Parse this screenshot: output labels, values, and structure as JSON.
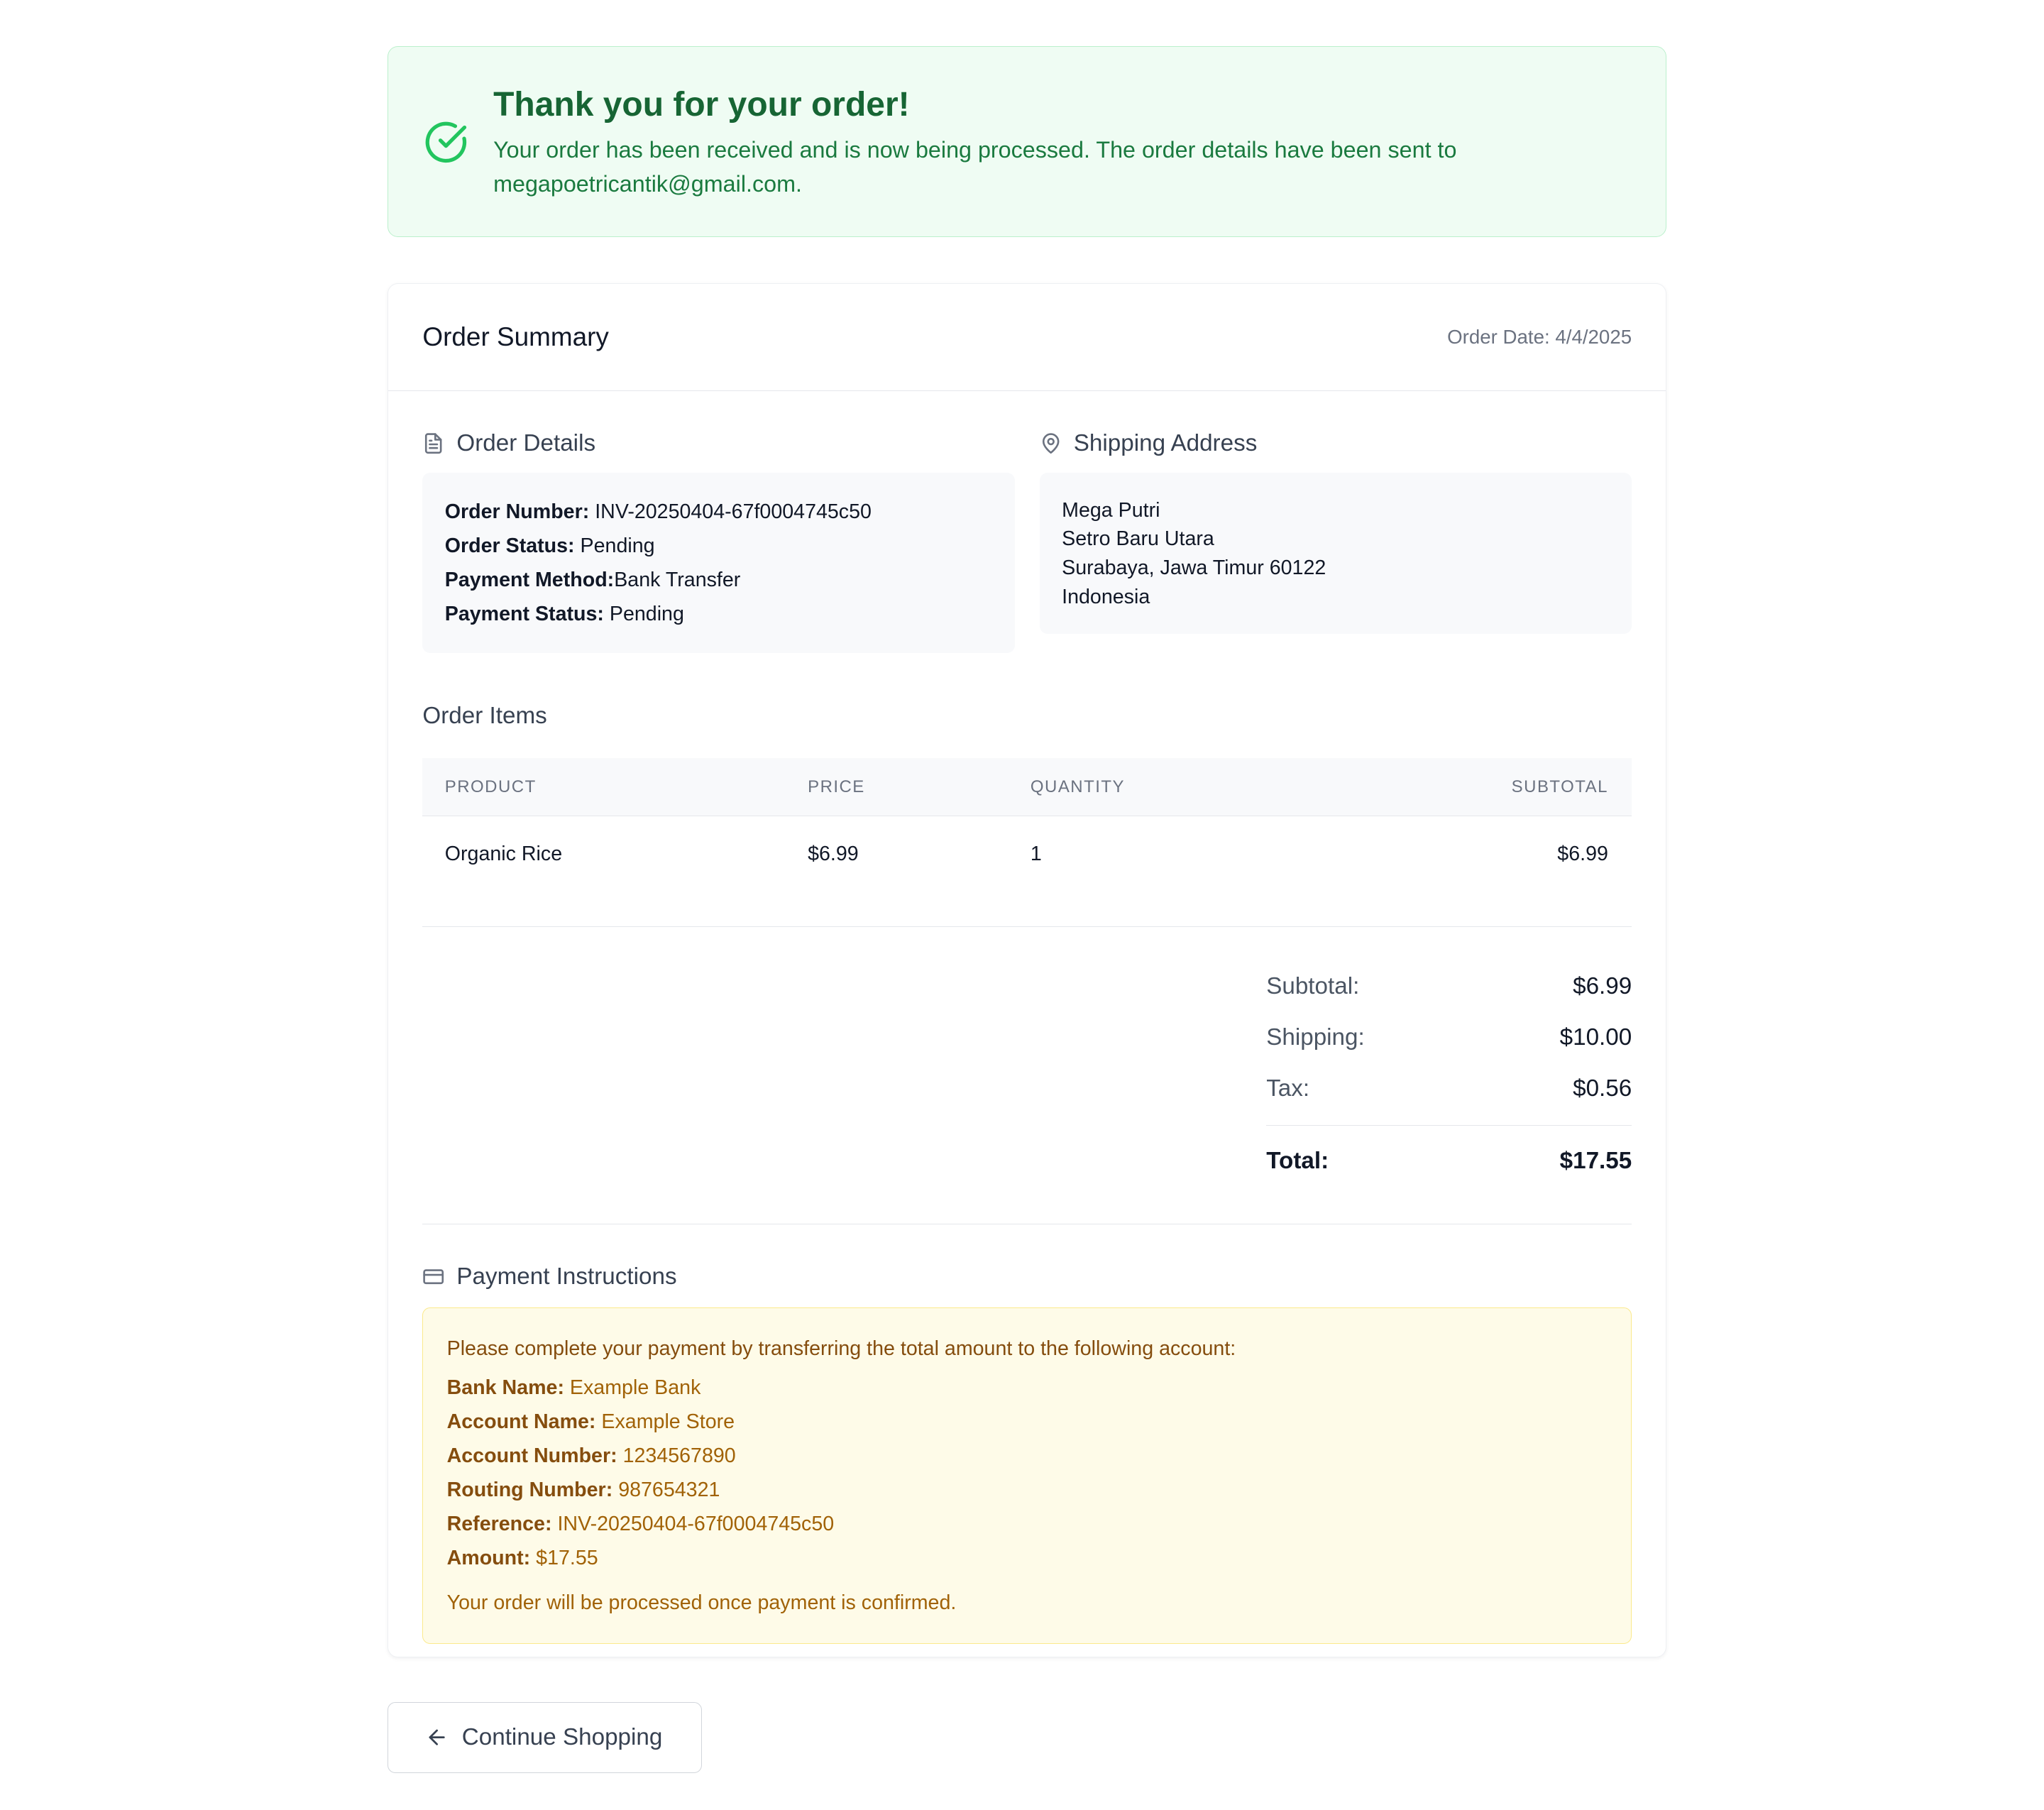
{
  "banner": {
    "title": "Thank you for your order!",
    "message": "Your order has been received and is now being processed. The order details have been sent to megapoetricantik@gmail.com.",
    "icon": "check-circle-icon",
    "accent": "#22c55e"
  },
  "summary": {
    "title": "Order Summary",
    "date": "Order Date: 4/4/2025"
  },
  "order_details": {
    "title": "Order Details",
    "number_label": "Order Number:",
    "number": "INV-20250404-67f0004745c50",
    "status_label": "Order Status:",
    "status": "Pending",
    "method_label": "Payment Method:",
    "method": "Bank Transfer",
    "pay_status_label": "Payment Status:",
    "pay_status": "Pending"
  },
  "shipping": {
    "title": "Shipping Address",
    "name": "Mega Putri",
    "street": "Setro Baru Utara",
    "city": "Surabaya, Jawa Timur 60122",
    "country": "Indonesia"
  },
  "items": {
    "title": "Order Items",
    "headers": [
      "PRODUCT",
      "PRICE",
      "QUANTITY",
      "SUBTOTAL"
    ],
    "rows": [
      {
        "product": "Organic Rice",
        "price": "$6.99",
        "quantity": "1",
        "subtotal": "$6.99"
      }
    ]
  },
  "totals": {
    "subtotal_label": "Subtotal:",
    "subtotal": "$6.99",
    "shipping_label": "Shipping:",
    "shipping": "$10.00",
    "tax_label": "Tax:",
    "tax": "$0.56",
    "total_label": "Total:",
    "total": "$17.55"
  },
  "payment": {
    "title": "Payment Instructions",
    "lead": "Please complete your payment by transferring the total amount to the following account:",
    "bank_label": "Bank Name:",
    "bank": "Example Bank",
    "account_name_label": "Account Name:",
    "account_name": "Example Store",
    "account_number_label": "Account Number:",
    "account_number": "1234567890",
    "routing_label": "Routing Number:",
    "routing": "987654321",
    "reference_label": "Reference:",
    "reference": "INV-20250404-67f0004745c50",
    "amount_label": "Amount:",
    "amount": "$17.55",
    "note": "Your order will be processed once payment is confirmed."
  },
  "actions": {
    "continue_label": "Continue Shopping"
  }
}
